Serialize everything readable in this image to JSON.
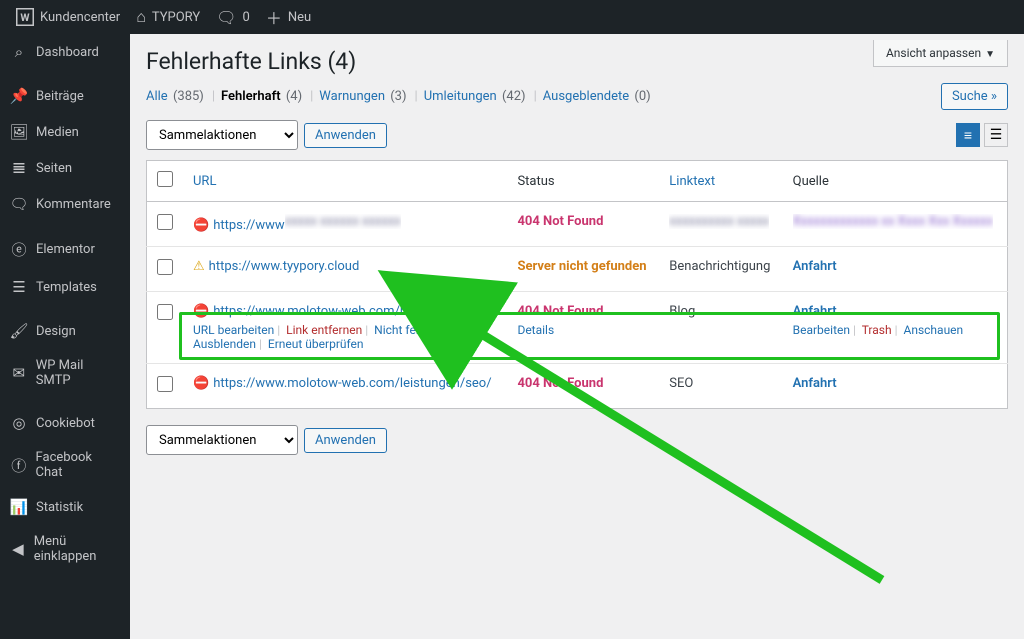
{
  "topbar": {
    "logo_label": "Kundencenter",
    "site_name": "TYPORY",
    "comment_count": "0",
    "new_label": "Neu"
  },
  "sidebar": {
    "items": [
      {
        "icon": "dashboard",
        "label": "Dashboard"
      },
      {
        "icon": "posts",
        "label": "Beiträge"
      },
      {
        "icon": "media",
        "label": "Medien"
      },
      {
        "icon": "pages",
        "label": "Seiten"
      },
      {
        "icon": "comments",
        "label": "Kommentare"
      },
      {
        "icon": "elementor",
        "label": "Elementor"
      },
      {
        "icon": "templates",
        "label": "Templates"
      },
      {
        "icon": "design",
        "label": "Design"
      },
      {
        "icon": "wp-mail",
        "label": "WP Mail SMTP"
      },
      {
        "icon": "cookiebot",
        "label": "Cookiebot"
      },
      {
        "icon": "facebook",
        "label": "Facebook Chat"
      },
      {
        "icon": "stats",
        "label": "Statistik"
      },
      {
        "icon": "collapse",
        "label": "Menü einklappen"
      }
    ]
  },
  "screen_options_label": "Ansicht anpassen",
  "page_title": "Fehlerhafte Links (4)",
  "filters": {
    "all": {
      "label": "Alle",
      "count": "(385)"
    },
    "broken": {
      "label": "Fehlerhaft",
      "count": "(4)"
    },
    "warnings": {
      "label": "Warnungen",
      "count": "(3)"
    },
    "redirects": {
      "label": "Umleitungen",
      "count": "(42)"
    },
    "dismissed": {
      "label": "Ausgeblendete",
      "count": "(0)"
    }
  },
  "search_btn": "Suche »",
  "bulk": {
    "placeholder": "Sammelaktionen",
    "apply": "Anwenden"
  },
  "columns": {
    "url": "URL",
    "status": "Status",
    "linktext": "Linktext",
    "source": "Quelle"
  },
  "rows": [
    {
      "kind": "error",
      "url_pre": "https://www",
      "url_blur": "xxxxx xxxxxx xxxxxx",
      "status_key": "404",
      "status": "404 Not Found",
      "linktext_blur": "xxxxxxxxxx xxxxx",
      "source_blur": "Xxxxxxxxxxxxx xx Xxxx  Xxx Xxxxxx"
    },
    {
      "kind": "warn",
      "url": "https://www.tyypory.cloud",
      "status_key": "noserver",
      "status": "Server nicht gefunden",
      "linktext": "Benachrichtigung",
      "source": "Anfahrt"
    },
    {
      "kind": "error",
      "url": "https://www.molotow-web.com/block/",
      "status_key": "404",
      "status": "404 Not Found",
      "linktext": "Blog",
      "source": "Anfahrt",
      "hover": true,
      "actions_src": [
        "Bearbeiten",
        "Trash",
        "Anschauen"
      ]
    },
    {
      "kind": "error",
      "url": "https://www.molotow-web.com/leistungen/seo/",
      "status_key": "404",
      "status": "404 Not Found",
      "linktext": "SEO",
      "source": "Anfahrt"
    }
  ],
  "row_actions": {
    "edit_url": "URL bearbeiten",
    "unlink": "Link entfernen",
    "not_broken": "Nicht fehlerhaft",
    "dismiss": "Ausblenden",
    "recheck": "Erneut überprüfen",
    "details": "Details"
  }
}
